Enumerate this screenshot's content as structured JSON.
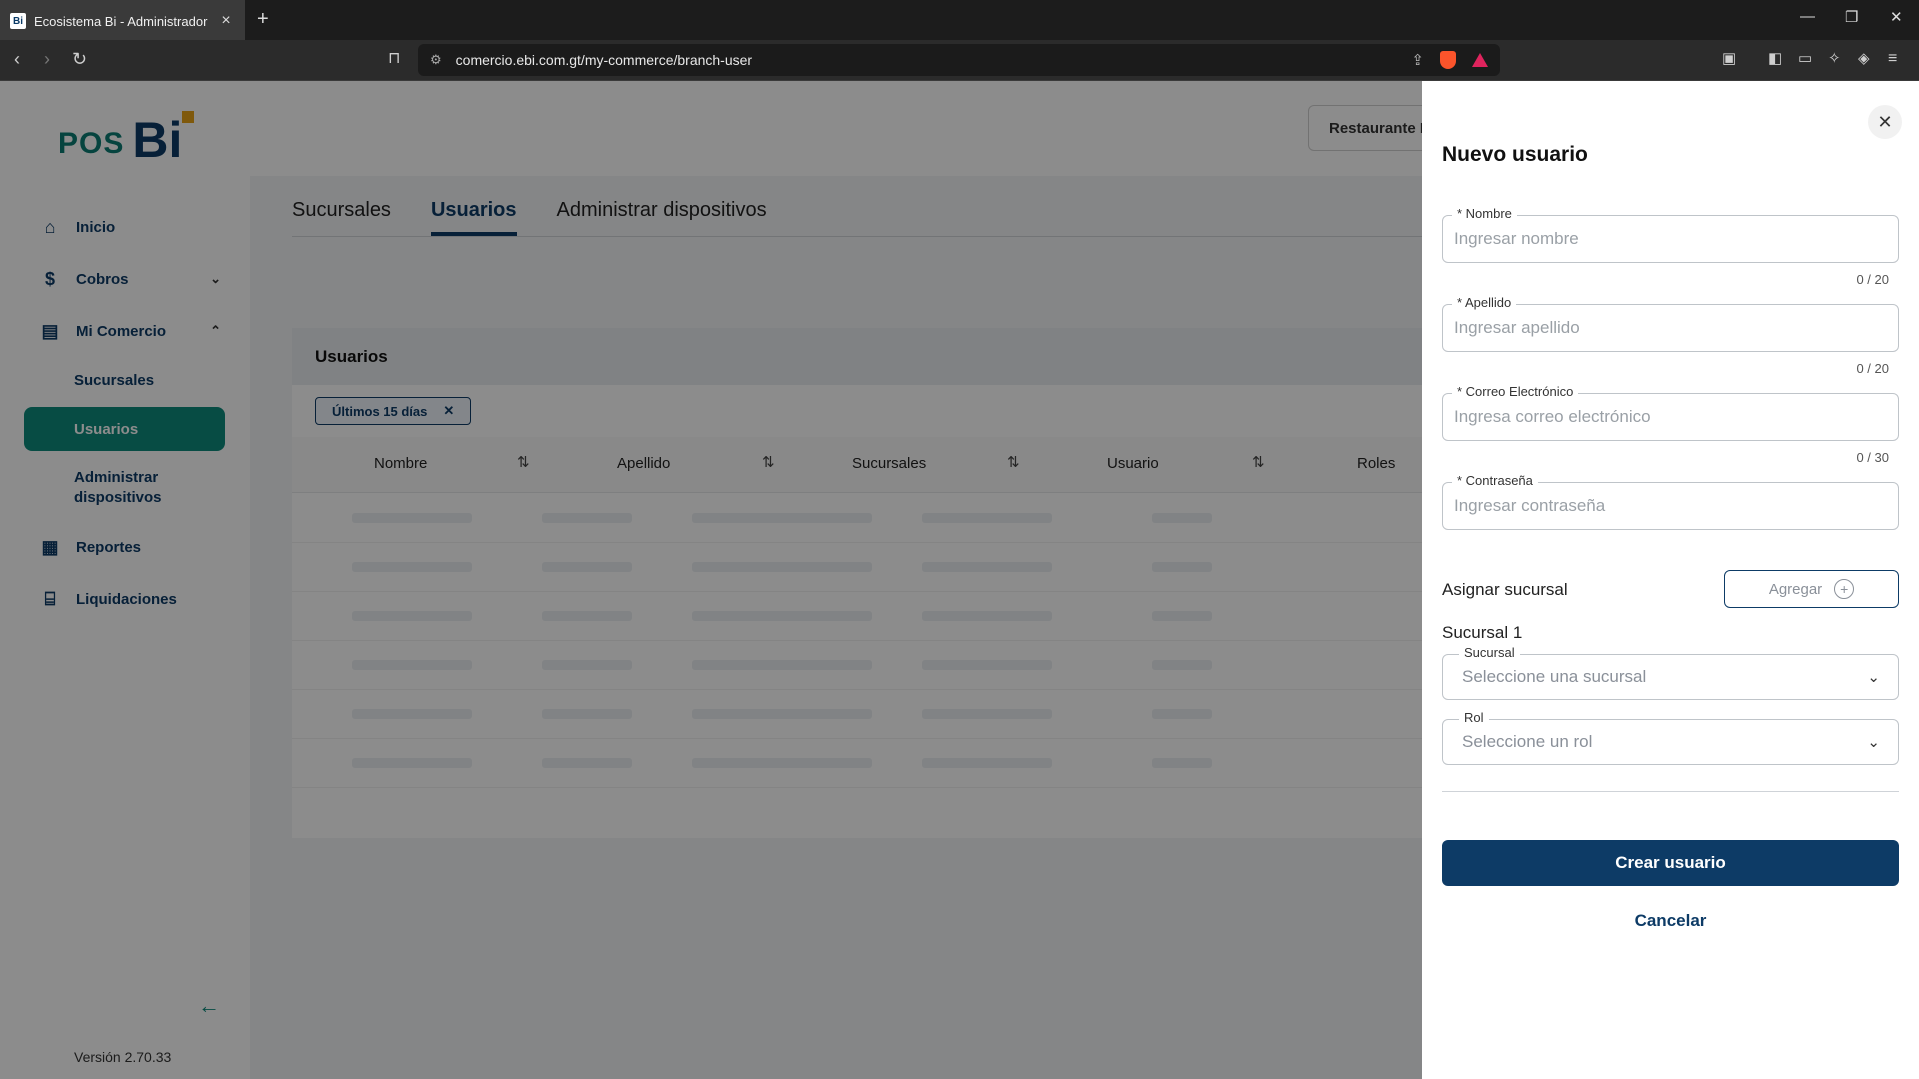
{
  "browser": {
    "tab_title": "Ecosistema Bi - Administrador",
    "favicon_text": "Bi",
    "url": "comercio.ebi.com.gt/my-commerce/branch-user"
  },
  "sidebar": {
    "logo_pos": "POS",
    "logo_bi": "Bi",
    "items": [
      {
        "label": "Inicio",
        "icon": "home-icon"
      },
      {
        "label": "Cobros",
        "icon": "payments-icon"
      },
      {
        "label": "Mi Comercio",
        "icon": "store-icon"
      },
      {
        "label": "Reportes",
        "icon": "reports-icon"
      },
      {
        "label": "Liquidaciones",
        "icon": "bank-icon"
      }
    ],
    "subitems": [
      "Sucursales",
      "Usuarios",
      "Administrar dispositivos"
    ],
    "version": "Versión 2.70.33"
  },
  "header": {
    "restaurant_button": "Restaurante I"
  },
  "tabs": [
    "Sucursales",
    "Usuarios",
    "Administrar dispositivos"
  ],
  "card": {
    "title": "Usuarios",
    "filter_chip": "Últimos 15 días",
    "columns": [
      "Nombre",
      "Apellido",
      "Sucursales",
      "Usuario",
      "Roles"
    ]
  },
  "drawer": {
    "title": "Nuevo usuario",
    "fields": [
      {
        "label": "* Nombre",
        "placeholder": "Ingresar nombre",
        "counter": "0 / 20"
      },
      {
        "label": "* Apellido",
        "placeholder": "Ingresar apellido",
        "counter": "0 / 20"
      },
      {
        "label": "* Correo Electrónico",
        "placeholder": "Ingresa correo electrónico",
        "counter": "0 / 30"
      },
      {
        "label": "* Contraseña",
        "placeholder": "Ingresar contraseña"
      }
    ],
    "assign_label": "Asignar sucursal",
    "add_button": "Agregar",
    "branch_group": "Sucursal 1",
    "branch_select": {
      "label": "Sucursal",
      "placeholder": "Seleccione una sucursal"
    },
    "role_select": {
      "label": "Rol",
      "placeholder": "Seleccione un rol"
    },
    "submit_button": "Crear usuario",
    "cancel_button": "Cancelar"
  },
  "colors": {
    "primary": "#0d3b66",
    "accent": "#0e8a7c",
    "logo_square": "#e8a317"
  }
}
